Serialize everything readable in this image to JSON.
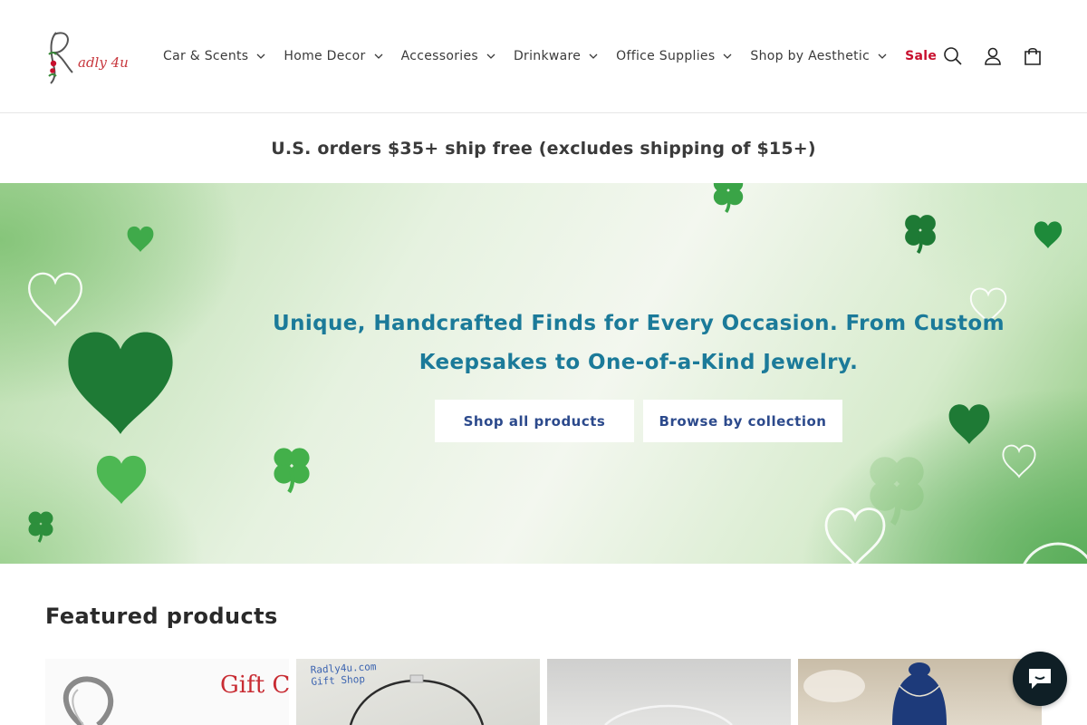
{
  "brand": {
    "logo_text": "Radly 4u",
    "accent_color": "#c8102e"
  },
  "nav": {
    "items": [
      {
        "label": "Car & Scents",
        "has_dropdown": true
      },
      {
        "label": "Home Decor",
        "has_dropdown": true
      },
      {
        "label": "Accessories",
        "has_dropdown": true
      },
      {
        "label": "Drinkware",
        "has_dropdown": true
      },
      {
        "label": "Office Supplies",
        "has_dropdown": true
      },
      {
        "label": "Shop by Aesthetic",
        "has_dropdown": true
      },
      {
        "label": "Sale",
        "has_dropdown": false
      }
    ]
  },
  "header_icons": [
    "search-icon",
    "account-icon",
    "cart-icon"
  ],
  "announcement": {
    "text": "U.S. orders $35+ ship free (excludes shipping of $15+)"
  },
  "hero": {
    "title": "Unique, Handcrafted Finds for Every Occasion. From Custom Keepsakes to One-of-a-Kind Jewelry.",
    "title_color": "#1b7a99",
    "buttons": [
      {
        "label": "Shop all products"
      },
      {
        "label": "Browse by collection"
      }
    ]
  },
  "featured": {
    "title": "Featured products",
    "products": [
      {
        "image_text": "Gift C"
      },
      {
        "image_text": "Radly4u.com\nGift Shop"
      },
      {
        "image_text": ""
      },
      {
        "image_text": ""
      }
    ]
  },
  "chat": {
    "icon": "chat-icon",
    "color": "#0f1f26"
  }
}
